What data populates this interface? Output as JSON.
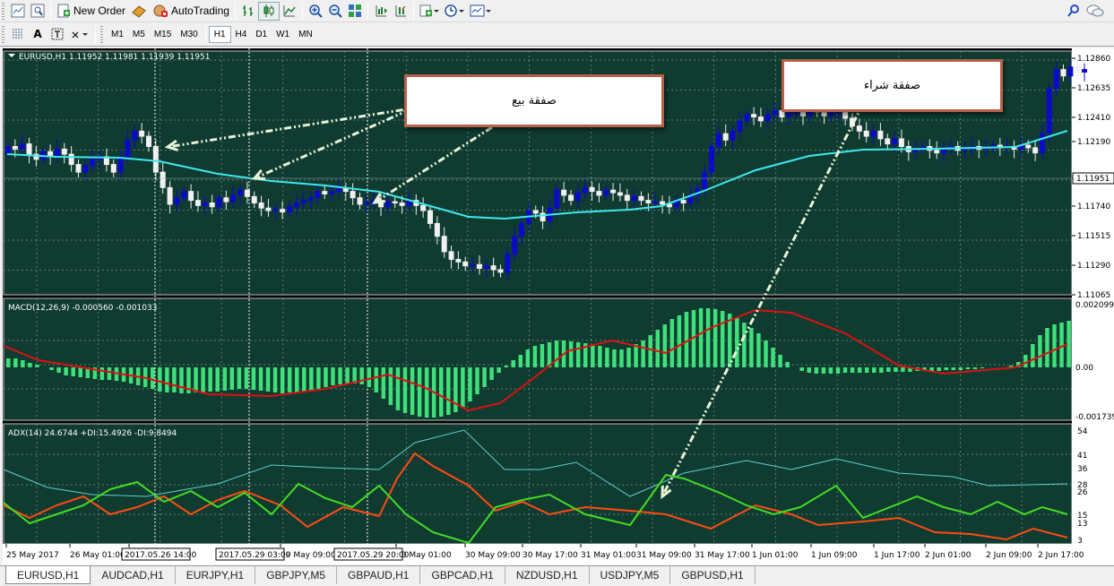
{
  "toolbar": {
    "new_order": "New Order",
    "auto_trading": "AutoTrading",
    "timeframes": [
      "M1",
      "M5",
      "M15",
      "M30",
      "H1",
      "H4",
      "D1",
      "W1",
      "MN"
    ],
    "active_timeframe": "H1"
  },
  "main_chart": {
    "header": "EURUSD,H1  1.11952 1.11981 1.11939 1.11951",
    "price_labels": [
      "1.12860",
      "1.12635",
      "1.12410",
      "1.12190",
      "1.11951",
      "1.11740",
      "1.11515",
      "1.11290",
      "1.11065"
    ],
    "current_price": "1.11951",
    "colors": {
      "background": "#0f3b30",
      "grid": "#7a9a90",
      "bull": "#0a0ac8",
      "bear": "#f0f0f0",
      "ma": "#40e8f0"
    }
  },
  "macd_panel": {
    "header": "MACD(12,26,9) -0.000560 -0.001033",
    "labels": [
      "0.002099",
      "0.00",
      "-0.001739"
    ],
    "colors": {
      "histogram": "#3ee07a",
      "signal": "#dd1111"
    }
  },
  "adx_panel": {
    "header": "ADX(14) 24.6744 +DI:15.4926 -DI:9.8494",
    "labels": [
      "54",
      "41",
      "36",
      "28",
      "26",
      "15",
      "13",
      "3"
    ],
    "colors": {
      "adx": "#5fd0d0",
      "plus_di": "#44dd22",
      "minus_di": "#ff4a14"
    }
  },
  "time_axis": {
    "labels": [
      "25 May 2017",
      "26 May 01:00",
      "26 May 17:00",
      "29 May 09:00",
      "30 May 01:00",
      "30 May 09:00",
      "30 May 17:00",
      "31 May 01:00",
      "31 May 09:00",
      "31 May 17:00",
      "1 Jun 01:00",
      "1 Jun 09:00",
      "1 Jun 17:00",
      "2 Jun 01:00",
      "2 Jun 09:00",
      "2 Jun 17:00"
    ],
    "highlighted": [
      "2017.05.26 14:00",
      "2017.05.29 03:00",
      "2017.05.29 20:00"
    ]
  },
  "annotations": {
    "sell": "صفقة بيع",
    "buy": "صفقة شراء"
  },
  "tabs": [
    "EURUSD,H1",
    "AUDCAD,H1",
    "EURJPY,H1",
    "GBPJPY,M5",
    "GBPAUD,H1",
    "GBPCAD,H1",
    "NZDUSD,H1",
    "USDJPY,M5",
    "GBPUSD,H1"
  ],
  "active_tab": "EURUSD,H1"
}
